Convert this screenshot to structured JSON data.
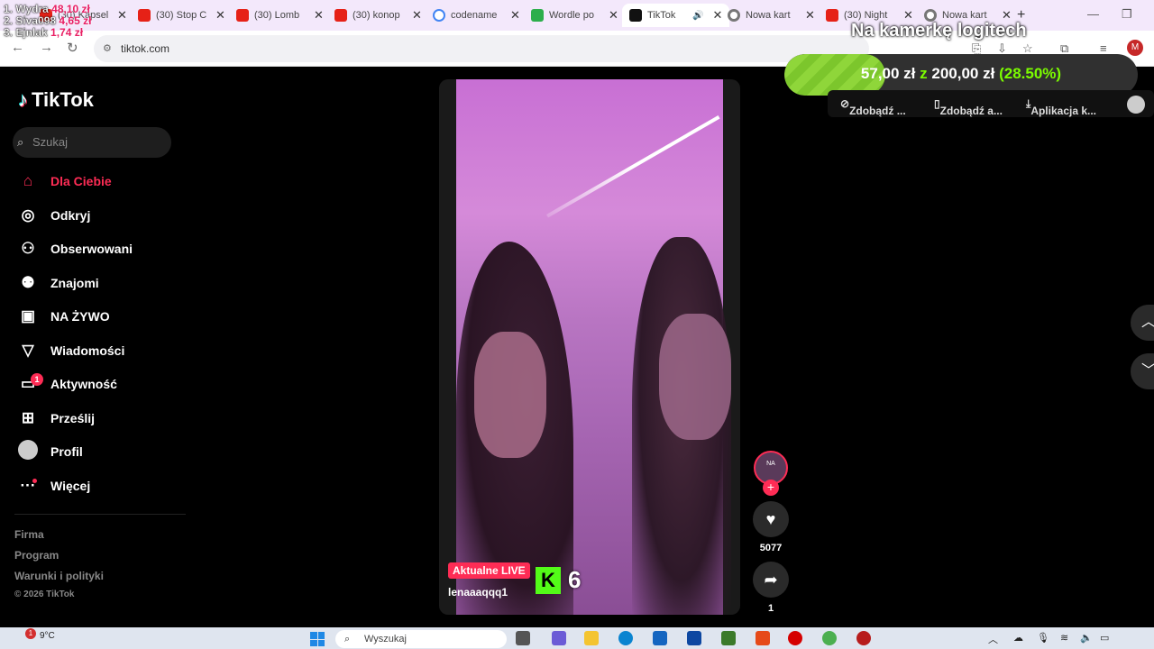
{
  "browser": {
    "tabs": [
      {
        "title": "(30) Kapsel",
        "icon": "youtube-icon"
      },
      {
        "title": "(30) Stop C",
        "icon": "youtube-icon"
      },
      {
        "title": "(30) Lomb",
        "icon": "youtube-icon"
      },
      {
        "title": "(30) konop",
        "icon": "youtube-icon"
      },
      {
        "title": "codename",
        "icon": "google-icon"
      },
      {
        "title": "Wordle po",
        "icon": "wordle-icon"
      },
      {
        "title": "TikTok",
        "icon": "tiktok-icon",
        "active": true
      },
      {
        "title": "Nowa kart",
        "icon": "chrome-icon"
      },
      {
        "title": "(30) Night",
        "icon": "youtube-icon"
      },
      {
        "title": "Nowa kart",
        "icon": "chrome-icon"
      }
    ],
    "url": "tiktok.com",
    "profile_initial": "M"
  },
  "overlay": {
    "donors": [
      {
        "name": "1. Wydra",
        "amount": "48,10 zł"
      },
      {
        "name": "2. Siva098",
        "amount": "4,65 zł"
      },
      {
        "name": "3. Ejnlak",
        "amount": "1,74 zł"
      }
    ],
    "camera_text": "Na kamerkę logitech",
    "goal": {
      "current": "57,00 zł",
      "sep": "z",
      "target": "200,00 zł",
      "percent_label": "(28.50%)",
      "progress": 0.285
    }
  },
  "tiktok_menu": {
    "items": [
      "Zdobądź ...",
      "Zdobądź a...",
      "Aplikacja k..."
    ]
  },
  "sidebar": {
    "logo": "TikTok",
    "search_placeholder": "Szukaj",
    "items": [
      {
        "label": "Dla Ciebie",
        "icon": "home-icon"
      },
      {
        "label": "Odkryj",
        "icon": "compass-icon"
      },
      {
        "label": "Obserwowani",
        "icon": "user-follow-icon"
      },
      {
        "label": "Znajomi",
        "icon": "friends-icon"
      },
      {
        "label": "NA ŻYWO",
        "icon": "live-tv-icon"
      },
      {
        "label": "Wiadomości",
        "icon": "send-icon"
      },
      {
        "label": "Aktywność",
        "icon": "activity-icon",
        "badge": "1"
      },
      {
        "label": "Prześlij",
        "icon": "upload-icon"
      },
      {
        "label": "Profil",
        "icon": "profile-avatar"
      },
      {
        "label": "Więcej",
        "icon": "more-icon"
      }
    ],
    "footer": [
      "Firma",
      "Program",
      "Warunki i polityki"
    ],
    "copyright": "© 2026 TikTok"
  },
  "video": {
    "live_badge": "Aktualne LIVE",
    "username": "lenaaaqqq1",
    "kick_count": "6"
  },
  "rail": {
    "avatar_label": "NA",
    "likes": "5077",
    "shares": "1"
  },
  "taskbar": {
    "weather": "9°C",
    "weather_badge": "1",
    "search_placeholder": "Wyszukaj"
  }
}
